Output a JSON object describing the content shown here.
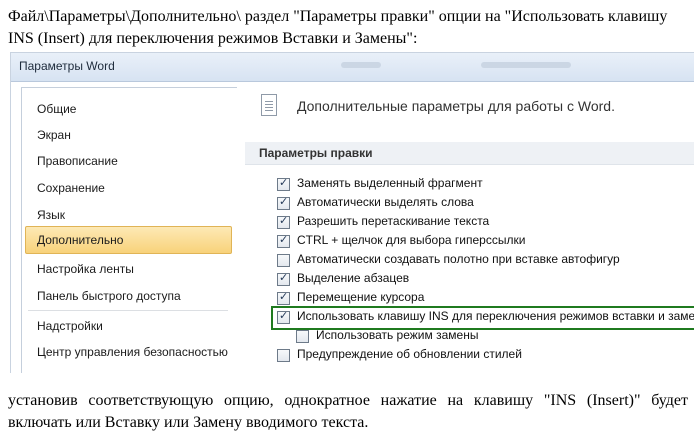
{
  "text": {
    "intro": "Файл\\Параметры\\Дополнительно\\ раздел \"Параметры правки\" опции на \"Использовать клавишу INS (Insert) для переключения режимов Вставки и Замены\":",
    "outro": "установив соответствующую опцию, однократное нажатие на клавишу \"INS (Insert)\" будет включать или Вставку или Замену вводимого текста."
  },
  "dialog": {
    "title": "Параметры Word",
    "nav": [
      {
        "label": "Общие"
      },
      {
        "label": "Экран"
      },
      {
        "label": "Правописание"
      },
      {
        "label": "Сохранение"
      },
      {
        "label": "Язык"
      },
      {
        "label": "Дополнительно",
        "active": true
      },
      {
        "label": "Настройка ленты"
      },
      {
        "label": "Панель быстрого доступа"
      },
      {
        "label": "Надстройки"
      },
      {
        "label": "Центр управления безопасностью"
      }
    ],
    "header": "Дополнительные параметры для работы с Word.",
    "section": "Параметры правки",
    "options": [
      {
        "label": "Заменять выделенный фрагмент",
        "checked": true
      },
      {
        "label": "Автоматически выделять слова",
        "checked": true
      },
      {
        "label": "Разрешить перетаскивание текста",
        "checked": true
      },
      {
        "label": "CTRL + щелчок для выбора гиперссылки",
        "checked": true
      },
      {
        "label": "Автоматически создавать полотно при вставке автофигур",
        "checked": false
      },
      {
        "label": "Выделение абзацев",
        "checked": true
      },
      {
        "label": "Перемещение курсора",
        "checked": true
      },
      {
        "label": "Использовать клавишу INS для переключения режимов вставки и замены",
        "checked": true,
        "highlighted": true
      },
      {
        "label": "Использовать режим замены",
        "checked": false
      },
      {
        "label": "Предупреждение об обновлении стилей",
        "checked": false
      }
    ],
    "highlight_color": "#1f7a1f",
    "active_nav_color": "#f8d27a"
  }
}
